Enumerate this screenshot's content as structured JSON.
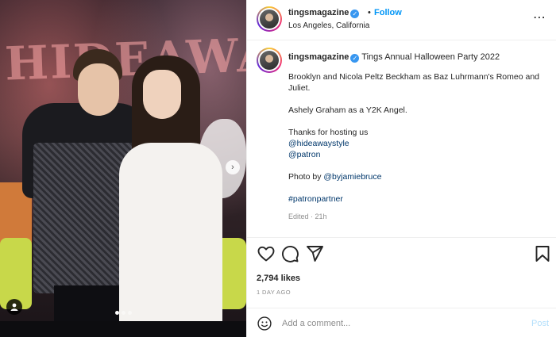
{
  "photo": {
    "neon_text": "HIDEAWAY",
    "carousel_count": 3,
    "carousel_active_index": 0,
    "next_glyph": "›"
  },
  "post_header": {
    "username": "tingsmagazine",
    "separator": "•",
    "follow_label": "Follow",
    "location": "Los Angeles, California",
    "more_glyph": "⋯"
  },
  "caption": {
    "username": "tingsmagazine",
    "headline": "Tings Annual Halloween Party 2022",
    "paragraph1": "Brooklyn and Nicola Peltz Beckham as Baz Luhrmann's Romeo and Juliet.",
    "paragraph2": "Ashely Graham as a Y2K Angel.",
    "thanks": "Thanks for hosting us",
    "mention1": "@hideawaystyle",
    "mention2": "@patron",
    "photo_by_prefix": "Photo by ",
    "photo_by_mention": "@byjamiebruce",
    "hashtag": "#patronpartner",
    "edited": "Edited · 21h"
  },
  "actions": {
    "icons": [
      "heart-icon",
      "comment-icon",
      "share-icon",
      "bookmark-icon"
    ]
  },
  "likes_text": "2,794 likes",
  "date_text": "1 DAY AGO",
  "comment": {
    "placeholder": "Add a comment...",
    "value": "",
    "post_label": "Post"
  },
  "colors": {
    "link": "#00376b",
    "follow": "#0095f6",
    "verified": "#3897f0",
    "post_disabled": "#b2dffc",
    "muted": "#8e8e8e"
  }
}
